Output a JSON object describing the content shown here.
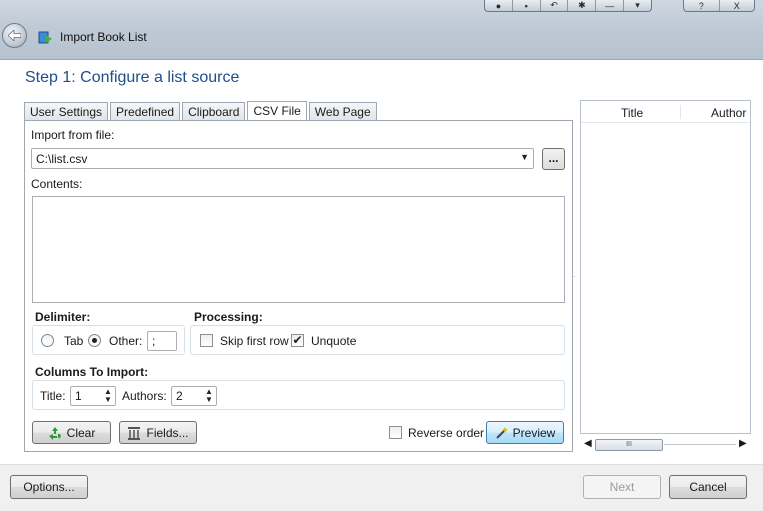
{
  "window": {
    "title": "Import Book List",
    "toolbar_icons": [
      "pin-icon",
      "document-icon",
      "undo-icon",
      "settings-icon",
      "minimize-bar-icon"
    ],
    "controls": {
      "help": "?",
      "close": "X"
    }
  },
  "step_title": "Step 1: Configure a list source",
  "tabs": [
    {
      "label": "User Settings",
      "active": false
    },
    {
      "label": "Predefined",
      "active": false
    },
    {
      "label": "Clipboard",
      "active": false
    },
    {
      "label": "CSV File",
      "active": true
    },
    {
      "label": "Web Page",
      "active": false
    }
  ],
  "csv": {
    "import_label": "Import from file:",
    "file_path": "C:\\list.csv",
    "browse_label": "...",
    "contents_label": "Contents:",
    "contents_value": ""
  },
  "delimiter": {
    "heading": "Delimiter:",
    "tab_label": "Tab",
    "other_label": "Other:",
    "other_value": ";",
    "selected": "Other"
  },
  "processing": {
    "heading": "Processing:",
    "skip_label": "Skip first row",
    "skip_checked": false,
    "unquote_label": "Unquote",
    "unquote_checked": true
  },
  "columns": {
    "heading": "Columns To Import:",
    "title_label": "Title:",
    "title_value": "1",
    "authors_label": "Authors:",
    "authors_value": "2"
  },
  "actions": {
    "clear_label": "Clear",
    "fields_label": "Fields...",
    "reverse_label": "Reverse order",
    "reverse_checked": false,
    "preview_label": "Preview"
  },
  "preview_list": {
    "columns": [
      "Title",
      "Author"
    ],
    "scroll_grip": "III"
  },
  "footer": {
    "options_label": "Options...",
    "next_label": "Next",
    "cancel_label": "Cancel"
  },
  "colors": {
    "step_title": "#1e4e8c",
    "titlebar": "#bfcad6",
    "focus_border": "#3c7fb1"
  }
}
